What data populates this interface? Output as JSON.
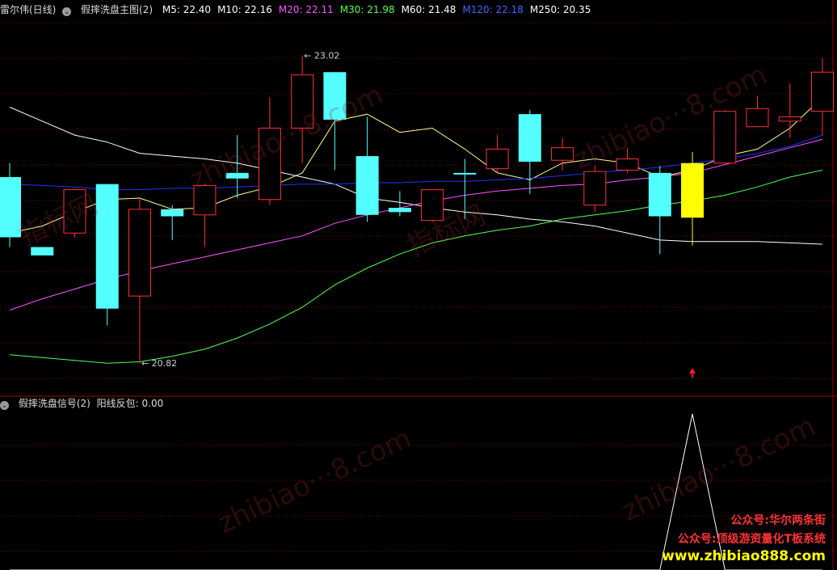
{
  "main_panel": {
    "stock_name": "雷尔伟(日线)",
    "indicator_name": "假摔洗盘主图(2)",
    "ma_readouts": [
      {
        "label": "M5: 22.40",
        "color": "#ffffff"
      },
      {
        "label": "M10: 22.16",
        "color": "#ffffff"
      },
      {
        "label": "M20: 22.11",
        "color": "#ff55ff"
      },
      {
        "label": "M30: 21.98",
        "color": "#55ff55"
      },
      {
        "label": "M60: 21.48",
        "color": "#ffffff"
      },
      {
        "label": "M120: 22.18",
        "color": "#4466ff"
      },
      {
        "label": "M250: 20.35",
        "color": "#ffffff"
      }
    ],
    "high_label": "23.02",
    "low_label": "20.82"
  },
  "sub_panel": {
    "indicator_name": "假摔洗盘信号(2)",
    "readout": "阳线反包: 0.00"
  },
  "watermarks": {
    "text_a": "zhibiao",
    "text_b": "8.com",
    "text_c": "指标网"
  },
  "promo": {
    "line1": "公众号:华尔两条街",
    "line2": "公众号:顶级游资量化T板系统",
    "line3": "www.zhibiao888.com",
    "color1": "#ff3333",
    "color3": "#ffff00"
  },
  "colors": {
    "up": "#ff3232",
    "down": "#54ffff",
    "signal": "#ffff00",
    "grid": "#5a0000",
    "divider": "#a00000"
  },
  "chart_data": {
    "type": "candlestick",
    "price_range": [
      20.7,
      23.3
    ],
    "candles": [
      {
        "o": 22.15,
        "h": 22.25,
        "l": 21.65,
        "c": 21.72
      },
      {
        "o": 21.65,
        "h": 21.65,
        "l": 21.65,
        "c": 21.59
      },
      {
        "o": 21.75,
        "h": 22.06,
        "l": 21.72,
        "c": 22.06
      },
      {
        "o": 22.1,
        "h": 22.1,
        "l": 21.09,
        "c": 21.21
      },
      {
        "o": 21.3,
        "h": 22.0,
        "l": 20.82,
        "c": 21.92
      },
      {
        "o": 21.92,
        "h": 21.95,
        "l": 21.7,
        "c": 21.87
      },
      {
        "o": 21.88,
        "h": 22.1,
        "l": 21.65,
        "c": 22.09
      },
      {
        "o": 22.18,
        "h": 22.45,
        "l": 22.0,
        "c": 22.14
      },
      {
        "o": 21.99,
        "h": 22.72,
        "l": 21.95,
        "c": 22.5
      },
      {
        "o": 22.5,
        "h": 23.02,
        "l": 22.25,
        "c": 22.88
      },
      {
        "o": 22.9,
        "h": 22.9,
        "l": 22.2,
        "c": 22.56
      },
      {
        "o": 22.3,
        "h": 22.58,
        "l": 21.83,
        "c": 21.88
      },
      {
        "o": 21.93,
        "h": 22.05,
        "l": 21.87,
        "c": 21.9
      },
      {
        "o": 21.84,
        "h": 22.05,
        "l": 21.83,
        "c": 22.06
      },
      {
        "o": 22.18,
        "h": 22.28,
        "l": 21.85,
        "c": 22.17
      },
      {
        "o": 22.21,
        "h": 22.45,
        "l": 22.18,
        "c": 22.35
      },
      {
        "o": 22.6,
        "h": 22.63,
        "l": 22.03,
        "c": 22.26
      },
      {
        "o": 22.27,
        "h": 22.43,
        "l": 22.2,
        "c": 22.36
      },
      {
        "o": 21.95,
        "h": 22.23,
        "l": 21.9,
        "c": 22.19
      },
      {
        "o": 22.2,
        "h": 22.36,
        "l": 22.18,
        "c": 22.28
      },
      {
        "o": 22.18,
        "h": 22.23,
        "l": 21.6,
        "c": 21.87
      },
      {
        "o": 21.86,
        "h": 22.33,
        "l": 21.66,
        "c": 22.25,
        "signal": true
      },
      {
        "o": 22.25,
        "h": 22.63,
        "l": 22.25,
        "c": 22.62
      },
      {
        "o": 22.51,
        "h": 22.73,
        "l": 22.55,
        "c": 22.64
      },
      {
        "o": 22.55,
        "h": 22.82,
        "l": 22.43,
        "c": 22.58
      },
      {
        "o": 22.62,
        "h": 23.0,
        "l": 22.45,
        "c": 22.9
      }
    ],
    "series": [
      {
        "color": "#ffffff",
        "values": [
          22.65,
          22.55,
          22.45,
          22.4,
          22.32,
          22.3,
          22.28,
          22.25,
          22.2,
          22.15,
          22.1,
          22.0,
          21.97,
          21.93,
          21.9,
          21.88,
          21.85,
          21.83,
          21.8,
          21.75,
          21.7,
          21.69,
          21.69,
          21.69,
          21.68,
          21.67
        ]
      },
      {
        "color": "#ffff99",
        "values": [
          21.75,
          21.8,
          21.9,
          21.99,
          22.0,
          21.92,
          21.93,
          22.02,
          22.08,
          22.18,
          22.55,
          22.6,
          22.47,
          22.5,
          22.35,
          22.18,
          22.13,
          22.25,
          22.28,
          22.25,
          22.15,
          22.2,
          22.3,
          22.35,
          22.5,
          22.72
        ]
      },
      {
        "color": "#ff55ff",
        "values": [
          21.2,
          21.28,
          21.35,
          21.42,
          21.48,
          21.53,
          21.58,
          21.63,
          21.68,
          21.73,
          21.82,
          21.88,
          21.93,
          21.98,
          22.02,
          22.05,
          22.07,
          22.09,
          22.1,
          22.13,
          22.15,
          22.18,
          22.24,
          22.3,
          22.36,
          22.42
        ]
      },
      {
        "color": "#55ff55",
        "values": [
          20.88,
          20.86,
          20.84,
          20.82,
          20.83,
          20.87,
          20.92,
          21.0,
          21.1,
          21.22,
          21.38,
          21.5,
          21.6,
          21.68,
          21.73,
          21.77,
          21.8,
          21.85,
          21.88,
          21.91,
          21.95,
          21.98,
          22.02,
          22.08,
          22.15,
          22.2
        ]
      },
      {
        "color": "#2233ff",
        "values": [
          22.1,
          22.09,
          22.08,
          22.06,
          22.06,
          22.07,
          22.07,
          22.08,
          22.09,
          22.1,
          22.1,
          22.11,
          22.11,
          22.12,
          22.12,
          22.13,
          22.14,
          22.16,
          22.18,
          22.2,
          22.22,
          22.25,
          22.28,
          22.32,
          22.37,
          22.45
        ]
      }
    ],
    "signal_series": [
      0,
      0,
      0,
      0,
      0,
      0,
      0,
      0,
      0,
      0,
      0,
      0,
      0,
      0,
      0,
      0,
      0,
      0,
      0,
      0,
      0,
      1,
      0,
      0,
      0,
      0
    ]
  }
}
